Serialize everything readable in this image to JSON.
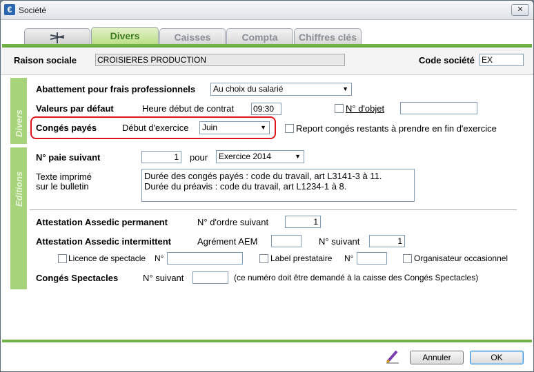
{
  "window": {
    "title": "Société",
    "close_glyph": "✕",
    "app_icon_glyph": "€"
  },
  "tabs": [
    {
      "label": "",
      "icon": "dragonfly-icon"
    },
    {
      "label": "Divers",
      "active": true
    },
    {
      "label": "Caisses"
    },
    {
      "label": "Compta"
    },
    {
      "label": "Chiffres clés"
    }
  ],
  "header": {
    "raison_label": "Raison sociale",
    "raison_value": "CROISIERES PRODUCTION",
    "code_label": "Code société",
    "code_value": "EX"
  },
  "divers": {
    "side_label": "Divers",
    "abattement_label": "Abattement pour frais professionnels",
    "abattement_value": "Au choix du salarié",
    "valeurs_label": "Valeurs par défaut",
    "heure_label": "Heure début de contrat",
    "heure_value": "09:30",
    "objet_label": "N° d'objet",
    "objet_value": "",
    "conges_label": "Congés payés",
    "debut_label": "Début d'exercice",
    "debut_value": "Juin",
    "report_label": "Report congés restants à prendre en fin d'exercice"
  },
  "editions": {
    "side_label": "Editions",
    "paie_label": "N° paie suivant",
    "paie_value": "1",
    "pour_label": "pour",
    "exercice_value": "Exercice 2014",
    "texte_label_1": "Texte imprimé",
    "texte_label_2": "sur le bulletin",
    "texte_value": "Durée des congés payés : code du travail, art L3141-3 à 11.\nDurée du préavis : code du travail, art L1234-1 à 8.",
    "assedic_perm_label": "Attestation Assedic permanent",
    "ordre_label": "N° d'ordre suivant",
    "ordre_value": "1",
    "assedic_inter_label": "Attestation Assedic intermittent",
    "agrement_label": "Agrément AEM",
    "agrement_value": "",
    "suivant_label": "N° suivant",
    "suivant_value": "1",
    "licence_label": "Licence de spectacle",
    "licence_no_label": "N°",
    "licence_value": "",
    "label_prest_label": "Label prestataire",
    "label_no_label": "N°",
    "label_value": "",
    "organisateur_label": "Organisateur occasionnel",
    "conges_spect_label": "Congés Spectacles",
    "cs_suivant_label": "N° suivant",
    "cs_value": "",
    "cs_note": "(ce numéro doit être demandé à la caisse des Congés Spectacles)"
  },
  "footer": {
    "cancel_label": "Annuler",
    "ok_label": "OK"
  },
  "colors": {
    "accent_green": "#6fb348",
    "side_tab_green": "#a7d37b",
    "highlight_red": "#e0121a"
  }
}
